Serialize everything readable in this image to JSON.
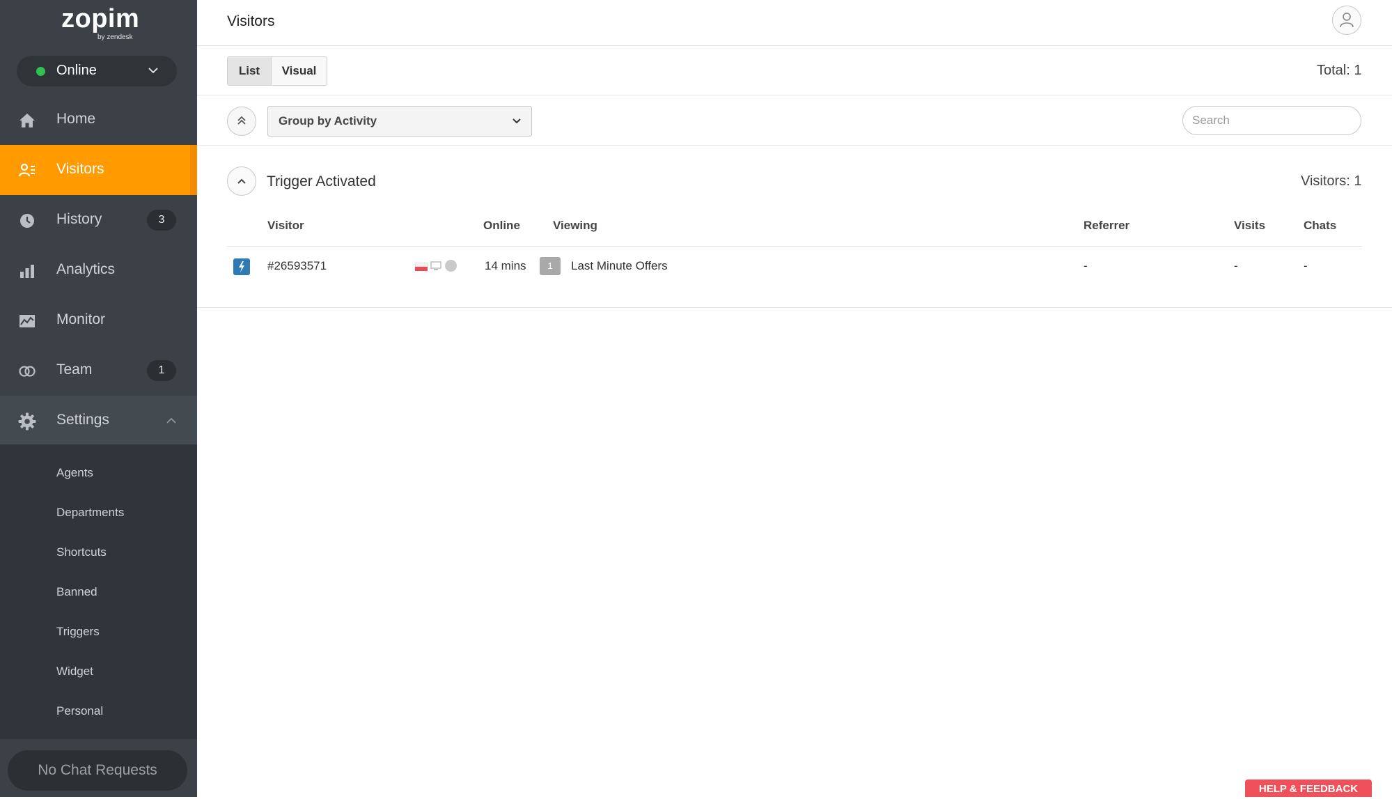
{
  "brand": {
    "name": "zopim",
    "tagline": "by zendesk"
  },
  "status": {
    "label": "Online",
    "color": "#31c24d"
  },
  "sidebar": {
    "items": [
      {
        "label": "Home",
        "icon": "home-icon"
      },
      {
        "label": "Visitors",
        "icon": "visitors-icon",
        "active": true
      },
      {
        "label": "History",
        "icon": "clock-icon",
        "badge": "3"
      },
      {
        "label": "Analytics",
        "icon": "bar-chart-icon"
      },
      {
        "label": "Monitor",
        "icon": "monitor-chart-icon"
      },
      {
        "label": "Team",
        "icon": "team-icon",
        "badge": "1"
      },
      {
        "label": "Settings",
        "icon": "gear-icon",
        "expanded": true
      }
    ],
    "settings_subitems": [
      "Agents",
      "Departments",
      "Shortcuts",
      "Banned",
      "Triggers",
      "Widget",
      "Personal"
    ],
    "footer_label": "No Chat Requests"
  },
  "header": {
    "title": "Visitors",
    "avatar_icon": "user-icon"
  },
  "view_toggle": {
    "list_label": "List",
    "visual_label": "Visual",
    "selected": "List"
  },
  "total_label": "Total: 1",
  "group_by": {
    "selected": "Group by Activity"
  },
  "search": {
    "placeholder": "Search",
    "value": ""
  },
  "group": {
    "title": "Trigger Activated",
    "count_label": "Visitors: 1"
  },
  "table": {
    "columns": [
      "Visitor",
      "Online",
      "Viewing",
      "Referrer",
      "Visits",
      "Chats"
    ],
    "rows": [
      {
        "icon": "trigger-icon",
        "visitor": "#26593571",
        "online": "14 mins",
        "page_count": "1",
        "viewing": "Last Minute Offers",
        "referrer": "-",
        "visits": "-",
        "chats": "-"
      }
    ]
  },
  "help_button": "HELP & FEEDBACK",
  "colors": {
    "accent": "#ff9a00",
    "sidebar": "#3b4147",
    "help": "#f0505a",
    "trigger_icon": "#2f79b4"
  }
}
